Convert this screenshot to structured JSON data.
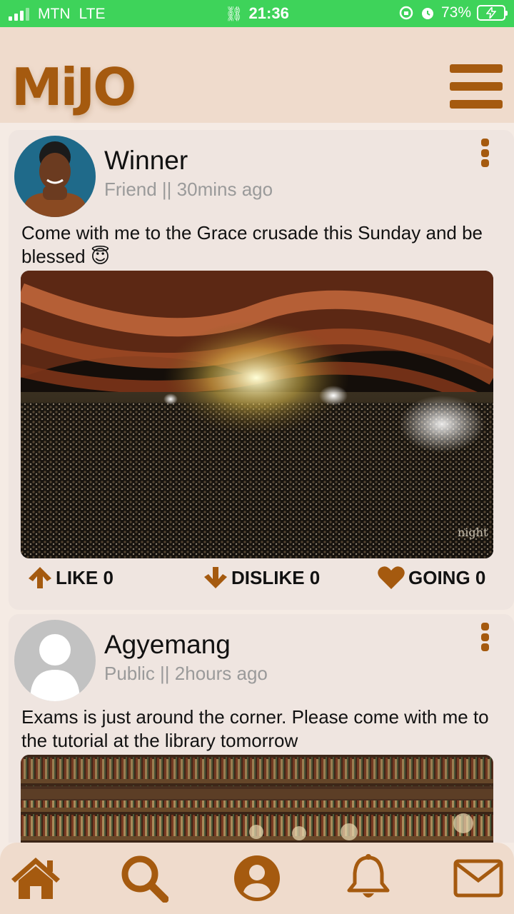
{
  "status_bar": {
    "carrier": "MTN",
    "network": "LTE",
    "time": "21:36",
    "battery": "73%"
  },
  "header": {
    "logo": "MiJO"
  },
  "colors": {
    "brand": "#a55a0f",
    "status_bar": "#3ed35a",
    "header_bg": "#efdbcc",
    "card_bg": "#efe5e0"
  },
  "posts": [
    {
      "author": "Winner",
      "meta": "Friend || 30mins ago",
      "text": "Come with me to the Grace crusade this Sunday and be blessed 😇",
      "image_caption": "night",
      "like_label": "LIKE 0",
      "dislike_label": "DISLIKE 0",
      "going_label": "GOING 0"
    },
    {
      "author": "Agyemang",
      "meta": "Public || 2hours ago",
      "text": "Exams is just around the corner. Please come with me to the tutorial at the library tomorrow"
    }
  ],
  "bottom_nav": {
    "items": [
      "home-icon",
      "search-icon",
      "profile-icon",
      "bell-icon",
      "mail-icon"
    ]
  }
}
